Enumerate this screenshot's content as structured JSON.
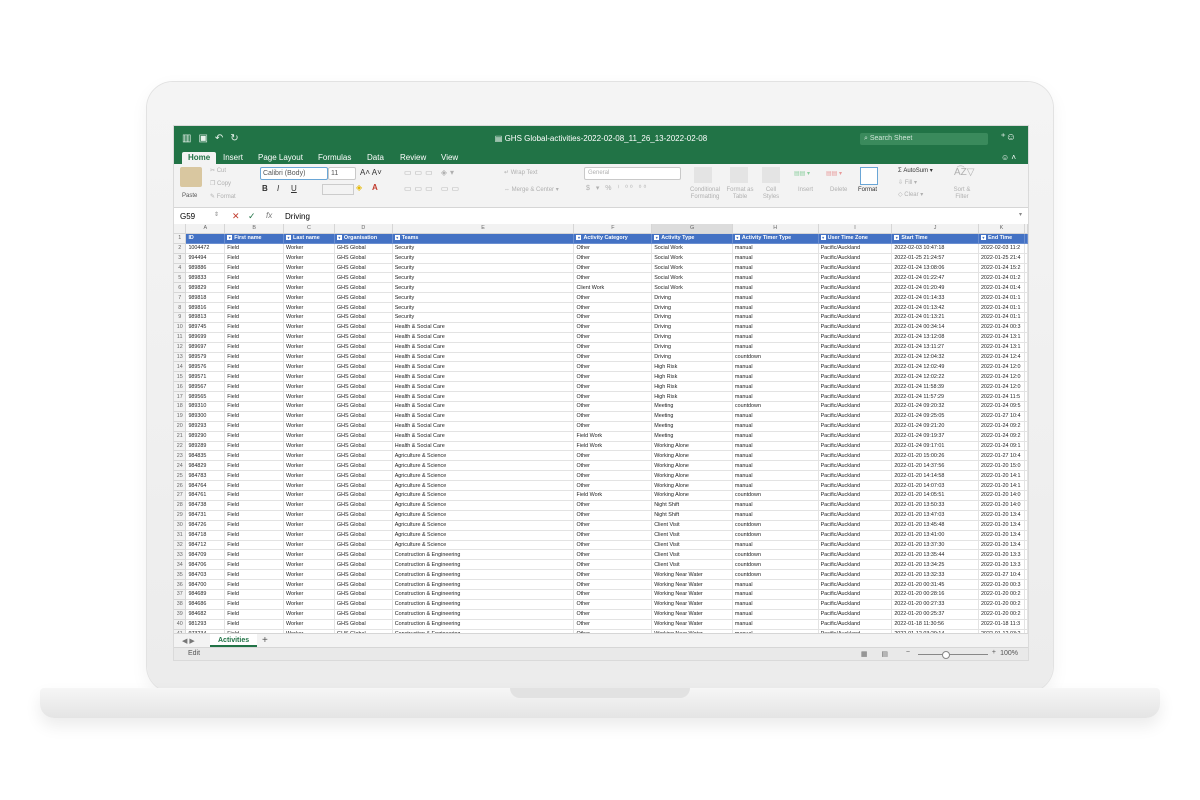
{
  "window": {
    "title": "GHS Global-activities-2022-02-08_11_26_13-2022-02-08",
    "search_placeholder": "Search Sheet",
    "share_icon": "add-person-icon"
  },
  "tabs": [
    {
      "label": "Home",
      "active": true
    },
    {
      "label": "Insert"
    },
    {
      "label": "Page Layout"
    },
    {
      "label": "Formulas"
    },
    {
      "label": "Data"
    },
    {
      "label": "Review"
    },
    {
      "label": "View"
    }
  ],
  "ribbon": {
    "paste": "Paste",
    "cut": "Cut",
    "copy": "Copy",
    "format_painter": "Format",
    "font_name": "Calibri (Body)",
    "font_size": "11",
    "bold": "B",
    "italic": "I",
    "underline": "U",
    "wrap_text": "Wrap Text",
    "merge_center": "Merge & Center",
    "number_format": "General",
    "conditional_formatting": "Conditional Formatting",
    "format_as_table": "Format as Table",
    "cell_styles": "Cell Styles",
    "insert": "Insert",
    "delete": "Delete",
    "format": "Format",
    "autosum": "AutoSum",
    "fill": "Fill",
    "clear": "Clear",
    "sort_filter": "Sort & Filter"
  },
  "formula_bar": {
    "name_box": "G59",
    "fx": "fx",
    "value": "Driving"
  },
  "columns": [
    "A",
    "B",
    "C",
    "D",
    "E",
    "F",
    "G",
    "H",
    "I",
    "J",
    "K"
  ],
  "header_row": [
    "ID",
    "First name",
    "Last name",
    "Organisation",
    "Teams",
    "Activity Category",
    "Activity Type",
    "Activity Timer Type",
    "User Time Zone",
    "Start Time",
    "End Time"
  ],
  "rows": [
    [
      "1004472",
      "Field",
      "Worker",
      "GHS Global",
      "Security",
      "Other",
      "Social Work",
      "manual",
      "Pacific/Auckland",
      "2022-02-03 10:47:18",
      "2022-02-03 11:2"
    ],
    [
      "994494",
      "Field",
      "Worker",
      "GHS Global",
      "Security",
      "Other",
      "Social Work",
      "manual",
      "Pacific/Auckland",
      "2022-01-25 21:24:57",
      "2022-01-25 21:4"
    ],
    [
      "989886",
      "Field",
      "Worker",
      "GHS Global",
      "Security",
      "Other",
      "Social Work",
      "manual",
      "Pacific/Auckland",
      "2022-01-24 13:08:06",
      "2022-01-24 15:2"
    ],
    [
      "989833",
      "Field",
      "Worker",
      "GHS Global",
      "Security",
      "Other",
      "Social Work",
      "manual",
      "Pacific/Auckland",
      "2022-01-24 01:22:47",
      "2022-01-24 01:2"
    ],
    [
      "989829",
      "Field",
      "Worker",
      "GHS Global",
      "Security",
      "Client Work",
      "Social Work",
      "manual",
      "Pacific/Auckland",
      "2022-01-24 01:20:49",
      "2022-01-24 01:4"
    ],
    [
      "989818",
      "Field",
      "Worker",
      "GHS Global",
      "Security",
      "Other",
      "Driving",
      "manual",
      "Pacific/Auckland",
      "2022-01-24 01:14:33",
      "2022-01-24 01:1"
    ],
    [
      "989816",
      "Field",
      "Worker",
      "GHS Global",
      "Security",
      "Other",
      "Driving",
      "manual",
      "Pacific/Auckland",
      "2022-01-24 01:13:42",
      "2022-01-24 01:1"
    ],
    [
      "989813",
      "Field",
      "Worker",
      "GHS Global",
      "Security",
      "Other",
      "Driving",
      "manual",
      "Pacific/Auckland",
      "2022-01-24 01:13:21",
      "2022-01-24 01:1"
    ],
    [
      "989745",
      "Field",
      "Worker",
      "GHS Global",
      "Health & Social Care",
      "Other",
      "Driving",
      "manual",
      "Pacific/Auckland",
      "2022-01-24 00:34:14",
      "2022-01-24 00:3"
    ],
    [
      "989699",
      "Field",
      "Worker",
      "GHS Global",
      "Health & Social Care",
      "Other",
      "Driving",
      "manual",
      "Pacific/Auckland",
      "2022-01-24 13:12:08",
      "2022-01-24 13:1"
    ],
    [
      "989697",
      "Field",
      "Worker",
      "GHS Global",
      "Health & Social Care",
      "Other",
      "Driving",
      "manual",
      "Pacific/Auckland",
      "2022-01-24 13:11:27",
      "2022-01-24 13:1"
    ],
    [
      "989579",
      "Field",
      "Worker",
      "GHS Global",
      "Health & Social Care",
      "Other",
      "Driving",
      "countdown",
      "Pacific/Auckland",
      "2022-01-24 12:04:32",
      "2022-01-24 12:4"
    ],
    [
      "989576",
      "Field",
      "Worker",
      "GHS Global",
      "Health & Social Care",
      "Other",
      "High Risk",
      "manual",
      "Pacific/Auckland",
      "2022-01-24 12:02:49",
      "2022-01-24 12:0"
    ],
    [
      "989571",
      "Field",
      "Worker",
      "GHS Global",
      "Health & Social Care",
      "Other",
      "High Risk",
      "manual",
      "Pacific/Auckland",
      "2022-01-24 12:02:22",
      "2022-01-24 12:0"
    ],
    [
      "989567",
      "Field",
      "Worker",
      "GHS Global",
      "Health & Social Care",
      "Other",
      "High Risk",
      "manual",
      "Pacific/Auckland",
      "2022-01-24 11:58:39",
      "2022-01-24 12:0"
    ],
    [
      "989565",
      "Field",
      "Worker",
      "GHS Global",
      "Health & Social Care",
      "Other",
      "High Risk",
      "manual",
      "Pacific/Auckland",
      "2022-01-24 11:57:29",
      "2022-01-24 11:5"
    ],
    [
      "989310",
      "Field",
      "Worker",
      "GHS Global",
      "Health & Social Care",
      "Other",
      "Meeting",
      "countdown",
      "Pacific/Auckland",
      "2022-01-24 09:20:32",
      "2022-01-24 09:5"
    ],
    [
      "989300",
      "Field",
      "Worker",
      "GHS Global",
      "Health & Social Care",
      "Other",
      "Meeting",
      "manual",
      "Pacific/Auckland",
      "2022-01-24 09:25:05",
      "2022-01-27 10:4"
    ],
    [
      "989293",
      "Field",
      "Worker",
      "GHS Global",
      "Health & Social Care",
      "Other",
      "Meeting",
      "manual",
      "Pacific/Auckland",
      "2022-01-24 09:21:20",
      "2022-01-24 09:2"
    ],
    [
      "989290",
      "Field",
      "Worker",
      "GHS Global",
      "Health & Social Care",
      "Field Work",
      "Meeting",
      "manual",
      "Pacific/Auckland",
      "2022-01-24 09:19:37",
      "2022-01-24 09:2"
    ],
    [
      "989289",
      "Field",
      "Worker",
      "GHS Global",
      "Health & Social Care",
      "Field Work",
      "Working Alone",
      "manual",
      "Pacific/Auckland",
      "2022-01-24 09:17:01",
      "2022-01-24 09:1"
    ],
    [
      "984835",
      "Field",
      "Worker",
      "GHS Global",
      "Agriculture & Science",
      "Other",
      "Working Alone",
      "manual",
      "Pacific/Auckland",
      "2022-01-20 15:00:26",
      "2022-01-27 10:4"
    ],
    [
      "984829",
      "Field",
      "Worker",
      "GHS Global",
      "Agriculture & Science",
      "Other",
      "Working Alone",
      "manual",
      "Pacific/Auckland",
      "2022-01-20 14:37:56",
      "2022-01-20 15:0"
    ],
    [
      "984783",
      "Field",
      "Worker",
      "GHS Global",
      "Agriculture & Science",
      "Other",
      "Working Alone",
      "manual",
      "Pacific/Auckland",
      "2022-01-20 14:14:58",
      "2022-01-20 14:1"
    ],
    [
      "984764",
      "Field",
      "Worker",
      "GHS Global",
      "Agriculture & Science",
      "Other",
      "Working Alone",
      "manual",
      "Pacific/Auckland",
      "2022-01-20 14:07:03",
      "2022-01-20 14:1"
    ],
    [
      "984761",
      "Field",
      "Worker",
      "GHS Global",
      "Agriculture & Science",
      "Field Work",
      "Working Alone",
      "countdown",
      "Pacific/Auckland",
      "2022-01-20 14:05:51",
      "2022-01-20 14:0"
    ],
    [
      "984738",
      "Field",
      "Worker",
      "GHS Global",
      "Agriculture & Science",
      "Other",
      "Night Shift",
      "manual",
      "Pacific/Auckland",
      "2022-01-20 13:50:33",
      "2022-01-20 14:0"
    ],
    [
      "984731",
      "Field",
      "Worker",
      "GHS Global",
      "Agriculture & Science",
      "Other",
      "Night Shift",
      "manual",
      "Pacific/Auckland",
      "2022-01-20 13:47:03",
      "2022-01-20 13:4"
    ],
    [
      "984726",
      "Field",
      "Worker",
      "GHS Global",
      "Agriculture & Science",
      "Other",
      "Client Visit",
      "countdown",
      "Pacific/Auckland",
      "2022-01-20 13:45:48",
      "2022-01-20 13:4"
    ],
    [
      "984718",
      "Field",
      "Worker",
      "GHS Global",
      "Agriculture & Science",
      "Other",
      "Client Visit",
      "countdown",
      "Pacific/Auckland",
      "2022-01-20 13:41:00",
      "2022-01-20 13:4"
    ],
    [
      "984712",
      "Field",
      "Worker",
      "GHS Global",
      "Agriculture & Science",
      "Other",
      "Client Visit",
      "manual",
      "Pacific/Auckland",
      "2022-01-20 13:37:30",
      "2022-01-20 13:4"
    ],
    [
      "984709",
      "Field",
      "Worker",
      "GHS Global",
      "Construction & Engineering",
      "Other",
      "Client Visit",
      "countdown",
      "Pacific/Auckland",
      "2022-01-20 13:35:44",
      "2022-01-20 13:3"
    ],
    [
      "984706",
      "Field",
      "Worker",
      "GHS Global",
      "Construction & Engineering",
      "Other",
      "Client Visit",
      "countdown",
      "Pacific/Auckland",
      "2022-01-20 13:34:25",
      "2022-01-20 13:3"
    ],
    [
      "984703",
      "Field",
      "Worker",
      "GHS Global",
      "Construction & Engineering",
      "Other",
      "Working Near Water",
      "countdown",
      "Pacific/Auckland",
      "2022-01-20 13:32:33",
      "2022-01-27 10:4"
    ],
    [
      "984700",
      "Field",
      "Worker",
      "GHS Global",
      "Construction & Engineering",
      "Other",
      "Working Near Water",
      "manual",
      "Pacific/Auckland",
      "2022-01-20 00:31:45",
      "2022-01-20 00:3"
    ],
    [
      "984689",
      "Field",
      "Worker",
      "GHS Global",
      "Construction & Engineering",
      "Other",
      "Working Near Water",
      "manual",
      "Pacific/Auckland",
      "2022-01-20 00:28:16",
      "2022-01-20 00:2"
    ],
    [
      "984686",
      "Field",
      "Worker",
      "GHS Global",
      "Construction & Engineering",
      "Other",
      "Working Near Water",
      "manual",
      "Pacific/Auckland",
      "2022-01-20 00:27:33",
      "2022-01-20 00:2"
    ],
    [
      "984682",
      "Field",
      "Worker",
      "GHS Global",
      "Construction & Engineering",
      "Other",
      "Working Near Water",
      "manual",
      "Pacific/Auckland",
      "2022-01-20 00:25:37",
      "2022-01-20 00:2"
    ],
    [
      "981293",
      "Field",
      "Worker",
      "GHS Global",
      "Construction & Engineering",
      "Other",
      "Working Near Water",
      "manual",
      "Pacific/Auckland",
      "2022-01-18 11:30:56",
      "2022-01-18 11:3"
    ],
    [
      "973234",
      "Field",
      "Worker",
      "GHS Global",
      "Construction & Engineering",
      "Other",
      "Working Near Water",
      "manual",
      "Pacific/Auckland",
      "2022-01-12 03:29:14",
      "2022-01-12 03:2"
    ],
    [
      "973230",
      "Field",
      "Worker",
      "GHS Global",
      "Construction & Engineering",
      "Other",
      "Working Near Water",
      "manual",
      "Pacific/Auckland",
      "2022-01-12 06:26:22",
      "2022-01-12 03:2"
    ],
    [
      "972998",
      "Field",
      "Worker",
      "GHS Global",
      "Security",
      "Field Work",
      "Working Near Water",
      "manual",
      "Pacific/Auckland",
      "2022-01-12 02:53:45",
      "2022-01-12 02:5"
    ],
    [
      "971057",
      "Field",
      "Worker",
      "GHS Global",
      "Security",
      "Other",
      "Working Near Water",
      "countdown",
      "Pacific/Auckland",
      "2022-01-10 23:45:32",
      "2022-01-10 23:4"
    ]
  ],
  "sheet_tabs": {
    "active": "Activities",
    "add": "+"
  },
  "status": {
    "mode": "Edit",
    "zoom": "100%"
  }
}
